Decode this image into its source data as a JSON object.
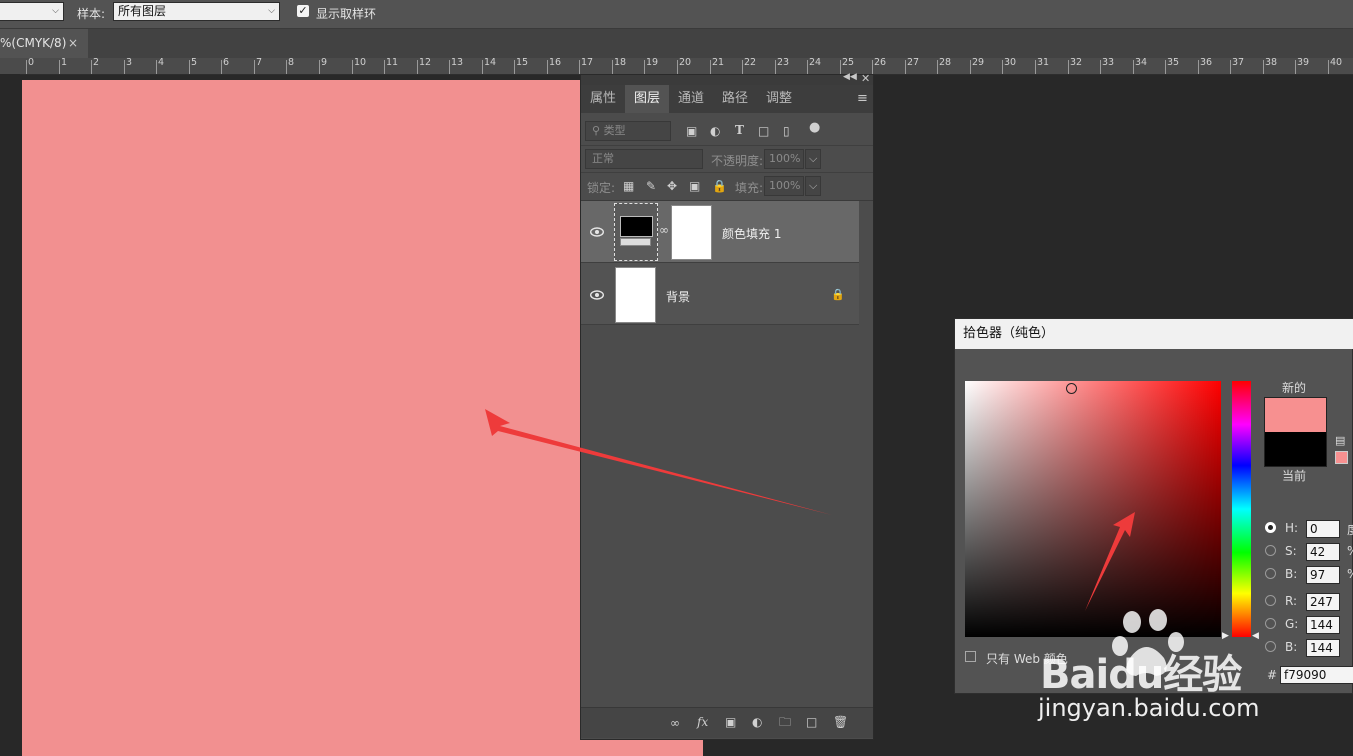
{
  "options_bar": {
    "sample_label": "样本:",
    "sample_value": "所有图层",
    "show_ring_label": "显示取样环",
    "show_ring_checked": true
  },
  "document_tab": {
    "title": "%(CMYK/8)",
    "close": "×"
  },
  "ruler": {
    "labels": [
      "0",
      "1",
      "2",
      "3",
      "4",
      "5",
      "6",
      "7",
      "8",
      "9",
      "10",
      "11",
      "12",
      "13",
      "14",
      "15",
      "16",
      "17",
      "18",
      "19",
      "20",
      "21",
      "22",
      "23",
      "24",
      "25",
      "26",
      "27",
      "28",
      "29",
      "30",
      "31",
      "32",
      "33",
      "34",
      "35",
      "36",
      "37",
      "38",
      "39",
      "40"
    ]
  },
  "canvas": {
    "fill_color": "#f29090"
  },
  "layers_panel": {
    "tabs": [
      "属性",
      "图层",
      "通道",
      "路径",
      "调整"
    ],
    "active_tab": "图层",
    "filter_label": "类型",
    "blend_mode": "正常",
    "opacity_label": "不透明度:",
    "opacity_value": "100%",
    "lock_label": "锁定:",
    "fill_label": "填充:",
    "fill_value": "100%",
    "layers": [
      {
        "name": "颜色填充 1",
        "selected": true
      },
      {
        "name": "背景",
        "locked": true
      }
    ],
    "footer_icons": [
      "link-icon",
      "fx-icon",
      "mask-icon",
      "adjustment-icon",
      "folder-icon",
      "new-layer-icon",
      "trash-icon"
    ]
  },
  "color_picker": {
    "title": "拾色器（纯色）",
    "new_label": "新的",
    "current_label": "当前",
    "new_color": "#f79090",
    "current_color": "#000000",
    "fields": [
      {
        "key": "H",
        "label": "H:",
        "value": "0",
        "unit": "度"
      },
      {
        "key": "S",
        "label": "S:",
        "value": "42",
        "unit": "%"
      },
      {
        "key": "B",
        "label": "B:",
        "value": "97",
        "unit": "%"
      },
      {
        "key": "R",
        "label": "R:",
        "value": "247"
      },
      {
        "key": "G",
        "label": "G:",
        "value": "144"
      },
      {
        "key": "Bl",
        "label": "B:",
        "value": "144"
      }
    ],
    "hex_label": "#",
    "hex_value": "f79090",
    "web_only_label": "只有 Web 颜色"
  },
  "watermark": {
    "brand": "Baidu经验",
    "url": "jingyan.baidu.com"
  }
}
